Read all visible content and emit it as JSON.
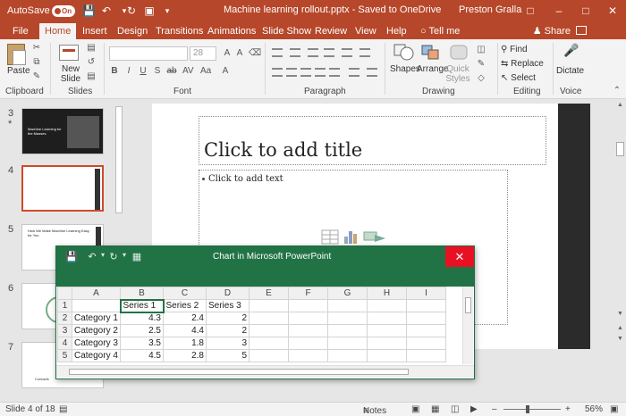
{
  "titlebar": {
    "autosave_label": "AutoSave",
    "autosave_state": "On",
    "doc_title": "Machine learning rollout.pptx  -  Saved to OneDrive",
    "user_name": "Preston Gralla",
    "icons": [
      "save-icon",
      "undo-icon",
      "redo-icon",
      "start-from-beginning-icon",
      "customize-qat-icon"
    ]
  },
  "tabs": [
    "File",
    "Home",
    "Insert",
    "Design",
    "Transitions",
    "Animations",
    "Slide Show",
    "Review",
    "View",
    "Help"
  ],
  "tellme": "Tell me",
  "share": "Share",
  "ribbon": {
    "clipboard": {
      "paste": "Paste",
      "label": "Clipboard"
    },
    "slides": {
      "new_slide": "New Slide",
      "label": "Slides"
    },
    "font": {
      "label": "Font",
      "size": "28"
    },
    "paragraph": {
      "label": "Paragraph"
    },
    "drawing": {
      "shapes": "Shapes",
      "arrange": "Arrange",
      "quick_styles": "Quick Styles",
      "label": "Drawing"
    },
    "editing": {
      "find": "Find",
      "replace": "Replace",
      "select": "Select",
      "label": "Editing"
    },
    "voice": {
      "dictate": "Dictate",
      "label": "Voice"
    }
  },
  "thumbnails": [
    {
      "num": "3",
      "marker": "*",
      "title": "Machine Learning for the Masses"
    },
    {
      "num": "4"
    },
    {
      "num": "5",
      "title": "How We Make Machine Learning Easy for You"
    },
    {
      "num": "6"
    },
    {
      "num": "7",
      "footer": "Contacts"
    }
  ],
  "slide": {
    "title_placeholder": "Click to add title",
    "body_placeholder": "Click to add text"
  },
  "chart_window": {
    "title": "Chart in Microsoft PowerPoint",
    "columns": [
      "A",
      "B",
      "C",
      "D",
      "E",
      "F",
      "G",
      "H",
      "I"
    ],
    "rows": [
      {
        "n": "1",
        "cells": [
          "",
          "Series 1",
          "Series 2",
          "Series 3",
          "",
          "",
          "",
          "",
          ""
        ]
      },
      {
        "n": "2",
        "cells": [
          "Category 1",
          "4.3",
          "2.4",
          "2",
          "",
          "",
          "",
          "",
          ""
        ]
      },
      {
        "n": "3",
        "cells": [
          "Category 2",
          "2.5",
          "4.4",
          "2",
          "",
          "",
          "",
          "",
          ""
        ]
      },
      {
        "n": "4",
        "cells": [
          "Category 3",
          "3.5",
          "1.8",
          "3",
          "",
          "",
          "",
          "",
          ""
        ]
      },
      {
        "n": "5",
        "cells": [
          "Category 4",
          "4.5",
          "2.8",
          "5",
          "",
          "",
          "",
          "",
          ""
        ]
      }
    ]
  },
  "statusbar": {
    "slide_info": "Slide 4 of 18",
    "notes": "Notes",
    "zoom": "56%"
  },
  "colors": {
    "ppt_accent": "#b7472a",
    "excel_accent": "#217346",
    "close_red": "#e81123"
  }
}
